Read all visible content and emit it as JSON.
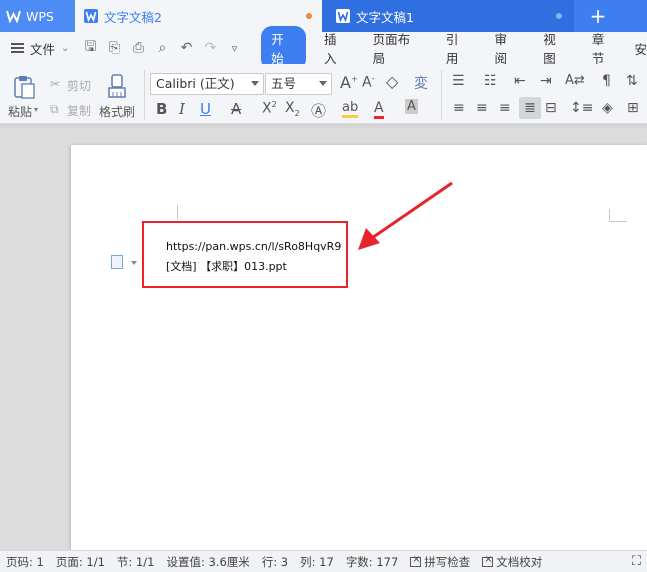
{
  "tabs": {
    "app": "WPS",
    "doc_active": "文字文稿2",
    "doc_other": "文字文稿1",
    "add": "+"
  },
  "menu": {
    "file": "文件",
    "tabs": [
      "开始",
      "插入",
      "页面布局",
      "引用",
      "审阅",
      "视图",
      "章节",
      "安"
    ]
  },
  "ribbon": {
    "paste": "粘贴",
    "cut": "剪切",
    "copy": "复制",
    "format_painter": "格式刷",
    "font_name": "Calibri (正文)",
    "font_size": "五号"
  },
  "document": {
    "line1": "https://pan.wps.cn/l/sRo8HqvR9",
    "line2": "[文档] 【求职】013.ppt"
  },
  "status": {
    "page": "页码: 1",
    "pages": "页面: 1/1",
    "section": "节: 1/1",
    "setting": "设置值: 3.6厘米",
    "row": "行: 3",
    "col": "列: 17",
    "words": "字数: 177",
    "spell": "拼写检查",
    "proof": "文档校对"
  },
  "colors": {
    "accent": "#3d7ef1",
    "annotation": "#e8232a",
    "modified_dot": "#f0883c"
  }
}
